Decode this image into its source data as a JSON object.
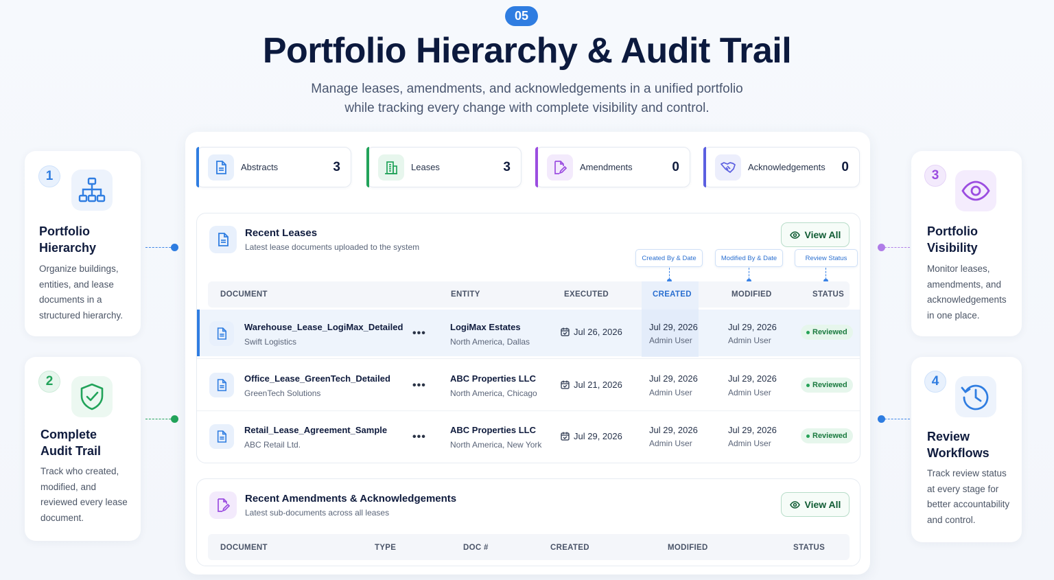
{
  "header": {
    "badge": "05",
    "title": "Portfolio Hierarchy & Audit Trail",
    "subtitle_line1": "Manage leases, amendments, and acknowledgements in a unified portfolio",
    "subtitle_line2": "while tracking every change with complete visibility and control."
  },
  "features": {
    "f1": {
      "num": "1",
      "title_l1": "Portfolio",
      "title_l2": "Hierarchy",
      "desc": [
        "Organize buildings,",
        "entities, and lease",
        "documents in a",
        "structured hierarchy."
      ],
      "icon": "hierarchy-icon"
    },
    "f2": {
      "num": "2",
      "title_l1": "Complete",
      "title_l2": "Audit Trail",
      "desc": [
        "Track who created,",
        "modified, and",
        "reviewed every lease",
        "document."
      ],
      "icon": "shield-check-icon"
    },
    "f3": {
      "num": "3",
      "title_l1": "Portfolio",
      "title_l2": "Visibility",
      "desc": [
        "Monitor leases,",
        "amendments, and",
        "acknowledgements",
        "in one place."
      ],
      "icon": "eye-icon"
    },
    "f4": {
      "num": "4",
      "title_l1": "Review",
      "title_l2": "Workflows",
      "desc": [
        "Track review status",
        "at every stage for",
        "better accountability",
        "and control."
      ],
      "icon": "history-clock-icon"
    }
  },
  "stats": [
    {
      "label": "Abstracts",
      "value": "3",
      "color": "#2f7de1",
      "icon": "document-icon"
    },
    {
      "label": "Leases",
      "value": "3",
      "color": "#22a35a",
      "icon": "building-icon"
    },
    {
      "label": "Amendments",
      "value": "0",
      "color": "#9b4de0",
      "icon": "edit-document-icon"
    },
    {
      "label": "Acknowledgements",
      "value": "0",
      "color": "#5b5fe0",
      "icon": "handshake-icon"
    }
  ],
  "recent_leases": {
    "title": "Recent Leases",
    "subtitle": "Latest lease documents uploaded to the system",
    "view_all": "View All",
    "tags": {
      "created": "Created By & Date",
      "modified": "Modified By & Date",
      "review": "Review Status"
    },
    "columns": {
      "document": "DOCUMENT",
      "entity": "ENTITY",
      "executed": "EXECUTED",
      "created": "CREATED",
      "modified": "MODIFIED",
      "status": "STATUS"
    },
    "rows": [
      {
        "name": "Warehouse_Lease_LogiMax_Detailed",
        "tenant": "Swift Logistics",
        "entity": "LogiMax Estates",
        "location": "North America, Dallas",
        "executed": "Jul 26, 2026",
        "created": "Jul 29, 2026",
        "created_by": "Admin User",
        "modified": "Jul 29, 2026",
        "modified_by": "Admin User",
        "status": "Reviewed"
      },
      {
        "name": "Office_Lease_GreenTech_Detailed",
        "tenant": "GreenTech Solutions",
        "entity": "ABC Properties LLC",
        "location": "North America, Chicago",
        "executed": "Jul 21, 2026",
        "created": "Jul 29, 2026",
        "created_by": "Admin User",
        "modified": "Jul 29, 2026",
        "modified_by": "Admin User",
        "status": "Reviewed"
      },
      {
        "name": "Retail_Lease_Agreement_Sample",
        "tenant": "ABC Retail Ltd.",
        "entity": "ABC Properties LLC",
        "location": "North America, New York",
        "executed": "Jul 29, 2026",
        "created": "Jul 29, 2026",
        "created_by": "Admin User",
        "modified": "Jul 29, 2026",
        "modified_by": "Admin User",
        "status": "Reviewed"
      }
    ],
    "more": "•••"
  },
  "recent_amendments": {
    "title": "Recent Amendments & Acknowledgements",
    "subtitle": "Latest sub-documents across all leases",
    "view_all": "View All",
    "columns": {
      "document": "DOCUMENT",
      "type": "TYPE",
      "doc_num": "DOC #",
      "created": "CREATED",
      "modified": "MODIFIED",
      "status": "STATUS"
    }
  }
}
